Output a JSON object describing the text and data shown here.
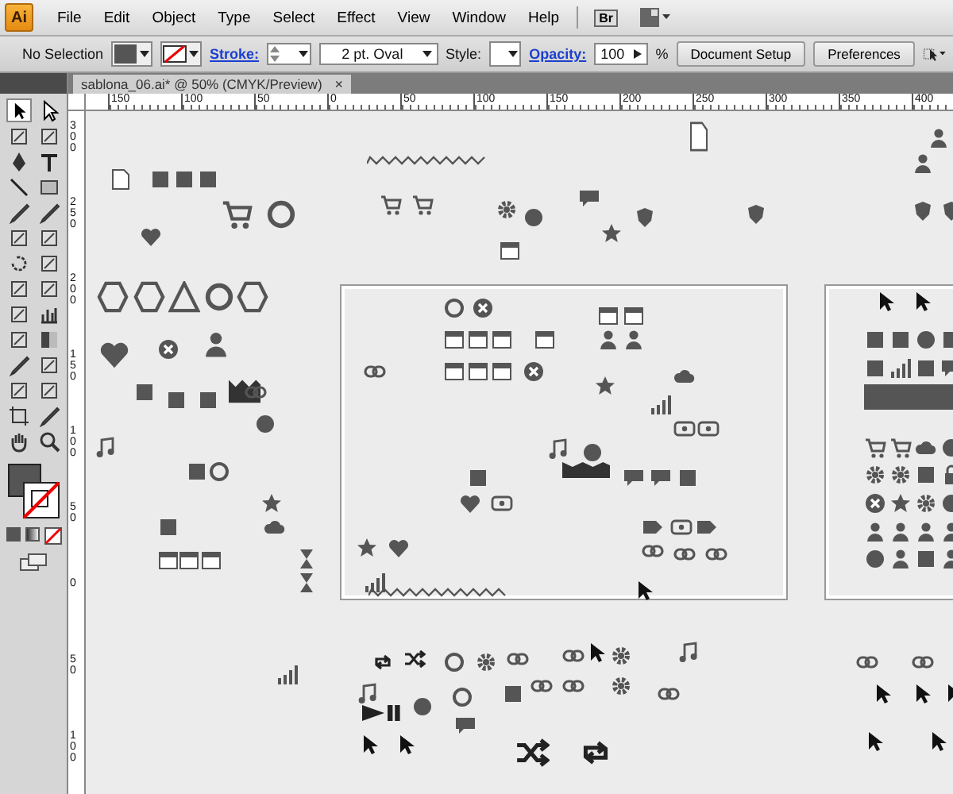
{
  "app": {
    "logo": "Ai"
  },
  "menu": [
    "File",
    "Edit",
    "Object",
    "Type",
    "Select",
    "Effect",
    "View",
    "Window",
    "Help"
  ],
  "bridge": {
    "label": "Br"
  },
  "control_bar": {
    "selection": "No Selection",
    "stroke_label": "Stroke:",
    "brush": "2 pt. Oval",
    "style_label": "Style:",
    "opacity_label": "Opacity:",
    "opacity": "100",
    "percent": "%",
    "buttons": [
      "Document Setup",
      "Preferences"
    ]
  },
  "document_tab": {
    "title": "sablona_06.ai* @ 50% (CMYK/Preview)",
    "close": "×"
  },
  "ruler": {
    "horizontal": [
      "150",
      "100",
      "50",
      "0",
      "50",
      "100",
      "150",
      "200",
      "250",
      "300",
      "350",
      "400"
    ],
    "vertical": [
      "300",
      "250",
      "200",
      "150",
      "100",
      "50",
      "0",
      "50",
      "100"
    ]
  }
}
